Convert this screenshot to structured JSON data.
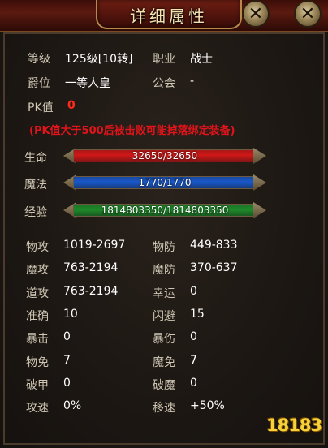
{
  "window": {
    "title": "详细属性",
    "close_glyph": "✕"
  },
  "basic": {
    "level_label": "等级",
    "level_value": "125级[10转]",
    "job_label": "职业",
    "job_value": "战士",
    "rank_label": "爵位",
    "rank_value": "一等人皇",
    "guild_label": "公会",
    "guild_value": "-",
    "pk_label": "PK值",
    "pk_value": "0",
    "pk_warning": "(PK值大于500后被击败可能掉落绑定装备)"
  },
  "bars": {
    "hp": {
      "label": "生命",
      "text": "32650/32650",
      "fraction": 1.0,
      "color": "#d01818"
    },
    "mp": {
      "label": "魔法",
      "text": "1770/1770",
      "fraction": 1.0,
      "color": "#1a58c8"
    },
    "exp": {
      "label": "经验",
      "text": "1814803350/1814803350",
      "fraction": 1.0,
      "color": "#1e8a2a"
    }
  },
  "stats": [
    {
      "l_label": "物攻",
      "l_value": "1019-2697",
      "r_label": "物防",
      "r_value": "449-833"
    },
    {
      "l_label": "魔攻",
      "l_value": "763-2194",
      "r_label": "魔防",
      "r_value": "370-637"
    },
    {
      "l_label": "道攻",
      "l_value": "763-2194",
      "r_label": "幸运",
      "r_value": "0"
    },
    {
      "l_label": "准确",
      "l_value": "10",
      "r_label": "闪避",
      "r_value": "15"
    },
    {
      "l_label": "暴击",
      "l_value": "0",
      "r_label": "暴伤",
      "r_value": "0"
    },
    {
      "l_label": "物免",
      "l_value": "7",
      "r_label": "魔免",
      "r_value": "7"
    },
    {
      "l_label": "破甲",
      "l_value": "0",
      "r_label": "破魔",
      "r_value": "0"
    },
    {
      "l_label": "攻速",
      "l_value": "0%",
      "r_label": "移速",
      "r_value": "+50%"
    }
  ],
  "watermark": "18183"
}
